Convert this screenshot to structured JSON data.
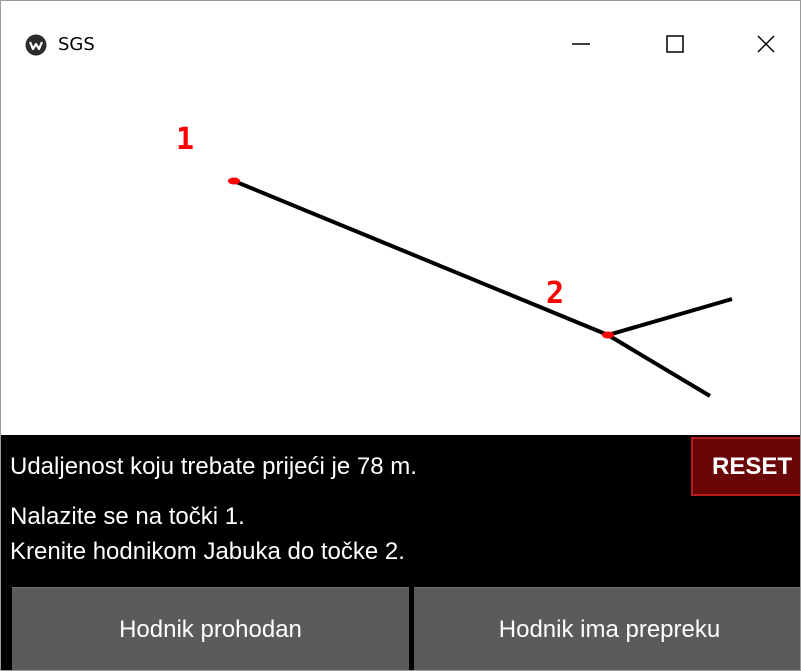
{
  "window": {
    "title": "SGS",
    "app_icon": "app-logo-icon",
    "controls": [
      "minimize-icon",
      "maximize-icon",
      "close-icon"
    ]
  },
  "map": {
    "line_color": "#000000",
    "point_color": "#ff0000",
    "points": [
      {
        "label": "1"
      },
      {
        "label": "2"
      }
    ]
  },
  "info": {
    "distance_text": "Udaljenost koju trebate prijeći je 78 m.",
    "location_text": "Nalazite se na točki 1.",
    "instruction_text": "Krenite hodnikom Jabuka do točke 2."
  },
  "reset_label": "RESET",
  "actions": {
    "passable_label": "Hodnik prohodan",
    "obstacle_label": "Hodnik ima prepreku"
  },
  "colors": {
    "panel_background": "#000000",
    "reset_background": "#6a0606",
    "reset_border": "#b61c1c",
    "button_background": "#5b5b5b"
  }
}
